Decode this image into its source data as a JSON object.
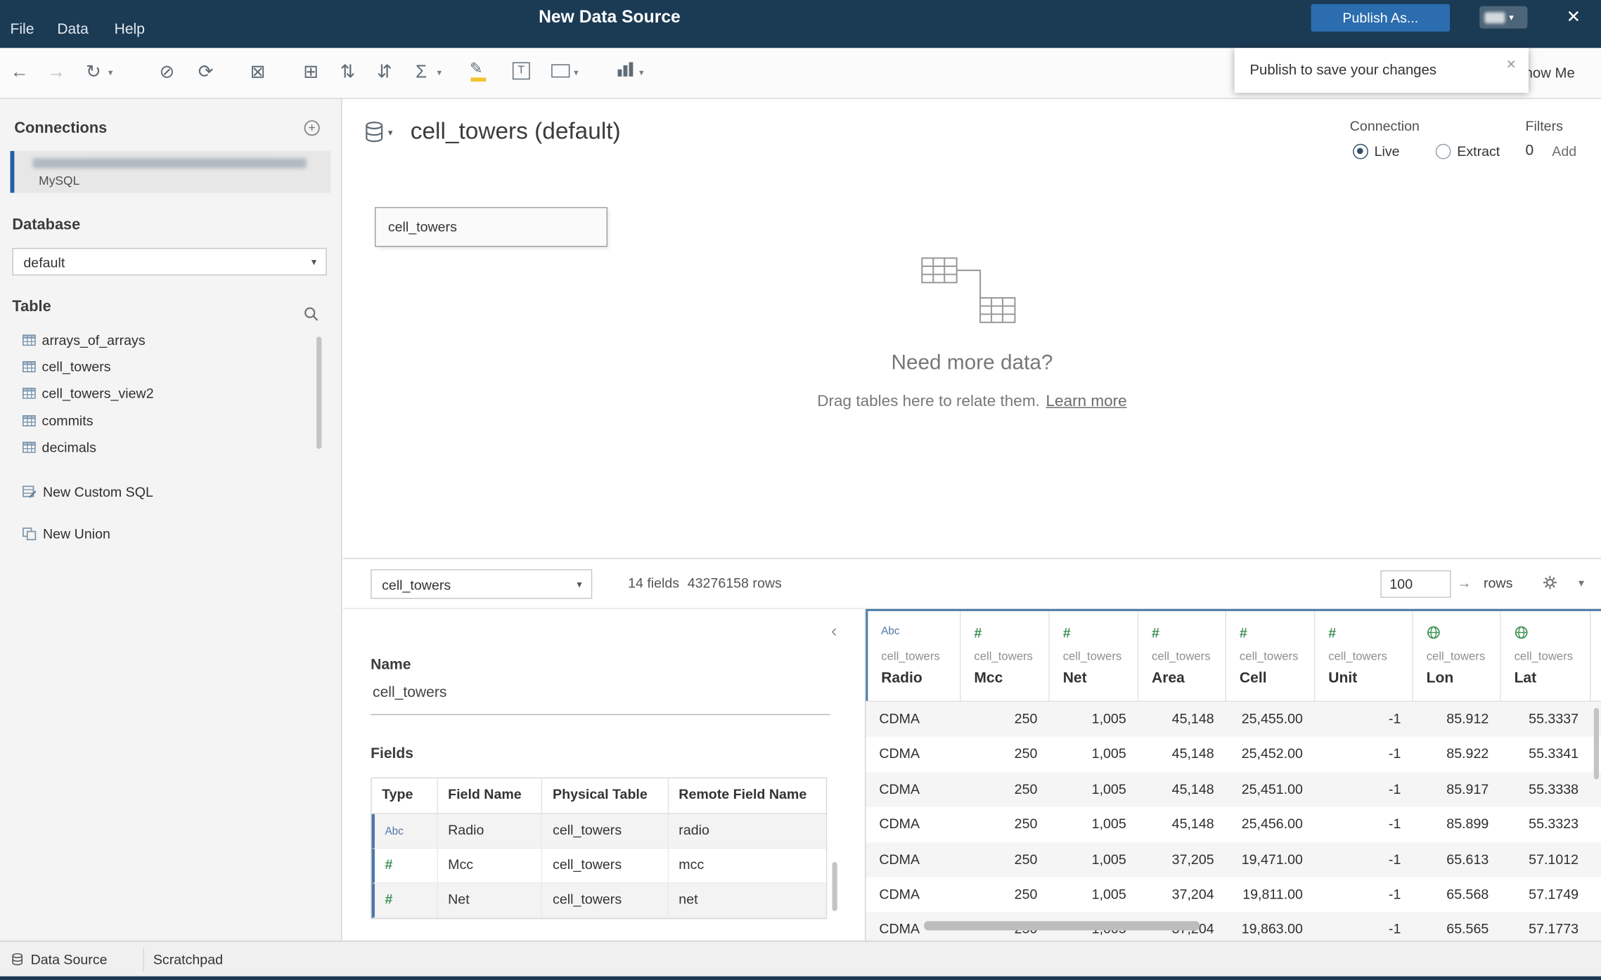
{
  "colors": {
    "topbar_navy": "#1b3a54",
    "accent_blue": "#2b6daf",
    "grid_header_blue": "#4a79a7",
    "type_abc_blue": "#4e79a7",
    "type_number_green": "#3f9154",
    "highlighter_yellow": "#f2c230"
  },
  "menubar": {
    "items": [
      "File",
      "Data",
      "Help"
    ],
    "title": "New Data Source",
    "publish_label": "Publish As..."
  },
  "tooltip": {
    "text": "Publish to save your changes"
  },
  "icons": {
    "undo": "←",
    "redo": "→",
    "replay": "↻",
    "pause_updates": "⊘",
    "run_update": "⟳",
    "cancel_update": "⊠",
    "add_field": "⊞",
    "sort_asc": "⇅",
    "sort_desc": "⇵",
    "totals": "Σ",
    "caret": "▾",
    "collapse": "‹",
    "arrow_right": "→",
    "close": "✕",
    "plus": "+",
    "pen": "✎"
  },
  "toolbar": {
    "show_me": "Show Me"
  },
  "sidebar": {
    "connections_header": "Connections",
    "connection_type": "MySQL",
    "database_header": "Database",
    "database_value": "default",
    "table_header": "Table",
    "tables": [
      "arrays_of_arrays",
      "cell_towers",
      "cell_towers_view2",
      "commits",
      "decimals"
    ],
    "new_custom_sql": "New Custom SQL",
    "new_union": "New Union"
  },
  "canvas": {
    "datasource_title": "cell_towers (default)",
    "connection_label": "Connection",
    "live_label": "Live",
    "extract_label": "Extract",
    "filters_label": "Filters",
    "filters_count": "0",
    "add_filter_label": "Add",
    "table_box_label": "cell_towers",
    "need_more_title": "Need more data?",
    "drag_hint": "Drag tables here to relate them.",
    "learn_more": "Learn more"
  },
  "databar": {
    "table_select_value": "cell_towers",
    "fields_summary": "14 fields",
    "rows_summary": "43276158 rows",
    "row_limit_value": "100",
    "rows_label": "rows"
  },
  "metadata": {
    "name_label": "Name",
    "name_value": "cell_towers",
    "fields_label": "Fields",
    "columns": [
      "Type",
      "Field Name",
      "Physical Table",
      "Remote Field Name"
    ],
    "rows": [
      {
        "type": "Abc",
        "field": "Radio",
        "table": "cell_towers",
        "remote": "radio"
      },
      {
        "type": "#",
        "field": "Mcc",
        "table": "cell_towers",
        "remote": "mcc"
      },
      {
        "type": "#",
        "field": "Net",
        "table": "cell_towers",
        "remote": "net"
      }
    ]
  },
  "grid": {
    "columns": [
      {
        "icon": "Abc",
        "table": "cell_towers",
        "name": "Radio"
      },
      {
        "icon": "#",
        "table": "cell_towers",
        "name": "Mcc"
      },
      {
        "icon": "#",
        "table": "cell_towers",
        "name": "Net"
      },
      {
        "icon": "#",
        "table": "cell_towers",
        "name": "Area"
      },
      {
        "icon": "#",
        "table": "cell_towers",
        "name": "Cell"
      },
      {
        "icon": "#",
        "table": "cell_towers",
        "name": "Unit"
      },
      {
        "icon": "globe",
        "table": "cell_towers",
        "name": "Lon"
      },
      {
        "icon": "globe",
        "table": "cell_towers",
        "name": "Lat"
      }
    ],
    "rows": [
      [
        "CDMA",
        "250",
        "1,005",
        "45,148",
        "25,455.00",
        "-1",
        "85.912",
        "55.3337"
      ],
      [
        "CDMA",
        "250",
        "1,005",
        "45,148",
        "25,452.00",
        "-1",
        "85.922",
        "55.3341"
      ],
      [
        "CDMA",
        "250",
        "1,005",
        "45,148",
        "25,451.00",
        "-1",
        "85.917",
        "55.3338"
      ],
      [
        "CDMA",
        "250",
        "1,005",
        "45,148",
        "25,456.00",
        "-1",
        "85.899",
        "55.3323"
      ],
      [
        "CDMA",
        "250",
        "1,005",
        "37,205",
        "19,471.00",
        "-1",
        "65.613",
        "57.1012"
      ],
      [
        "CDMA",
        "250",
        "1,005",
        "37,204",
        "19,811.00",
        "-1",
        "65.568",
        "57.1749"
      ],
      [
        "CDMA",
        "250",
        "1,005",
        "37,204",
        "19,863.00",
        "-1",
        "65.565",
        "57.1773"
      ]
    ]
  },
  "statusbar": {
    "tabs": [
      "Data Source",
      "Scratchpad"
    ]
  }
}
